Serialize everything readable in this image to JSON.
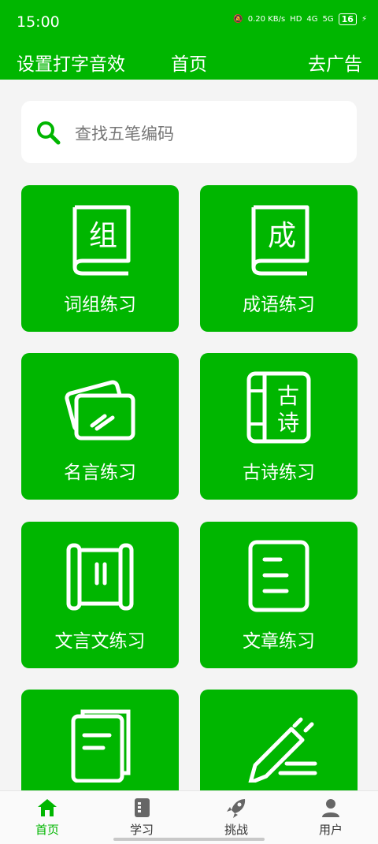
{
  "status": {
    "time": "15:00",
    "speed": "0.20 KB/s",
    "hd": "HD",
    "net1": "4G",
    "net2": "5G",
    "battery": "16"
  },
  "topbar": {
    "left": "设置打字音效",
    "title": "首页",
    "right": "去广告"
  },
  "search": {
    "placeholder": "查找五笔编码"
  },
  "cards": [
    {
      "label": "词组练习",
      "icon": "book-zu-icon",
      "book_char": "组"
    },
    {
      "label": "成语练习",
      "icon": "book-cheng-icon",
      "book_char": "成"
    },
    {
      "label": "名言练习",
      "icon": "cards-icon"
    },
    {
      "label": "古诗练习",
      "icon": "scroll-gushi-icon",
      "chars": [
        "古",
        "诗"
      ]
    },
    {
      "label": "文言文练习",
      "icon": "scroll-icon"
    },
    {
      "label": "文章练习",
      "icon": "document-icon"
    },
    {
      "label": "",
      "icon": "notebook-icon"
    },
    {
      "label": "",
      "icon": "pencil-icon"
    }
  ],
  "nav": [
    {
      "label": "首页",
      "icon": "home-icon",
      "active": true
    },
    {
      "label": "学习",
      "icon": "study-icon"
    },
    {
      "label": "挑战",
      "icon": "rocket-icon"
    },
    {
      "label": "用户",
      "icon": "user-icon"
    }
  ],
  "colors": {
    "primary": "#00b600",
    "background": "#f4f4f4"
  }
}
